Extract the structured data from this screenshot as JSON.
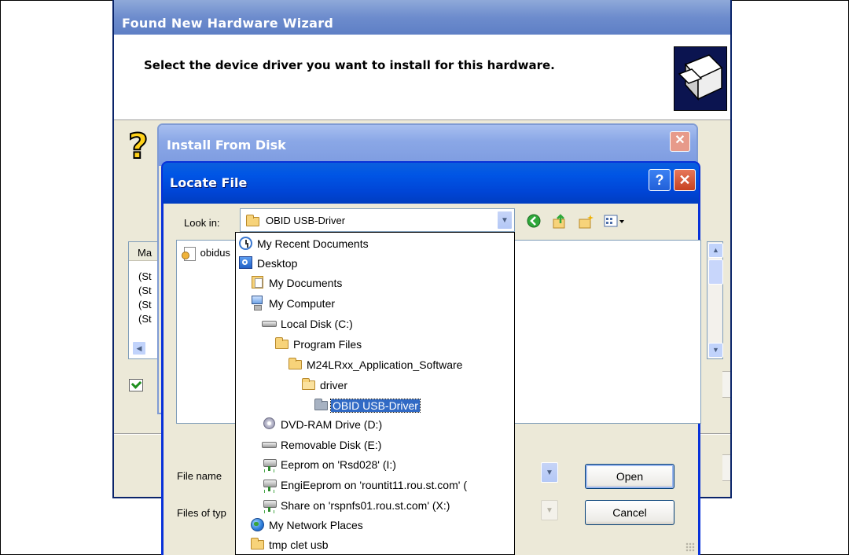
{
  "wizard": {
    "title": "Found New Hardware Wizard",
    "heading": "Select the device driver you want to install for this hardware."
  },
  "install_from_disk": {
    "title": "Install From Disk",
    "close_glyph": "✕"
  },
  "background_list": {
    "header": "Ma",
    "rows": [
      "(St",
      "(St",
      "(St",
      "(St"
    ]
  },
  "locate_file": {
    "title": "Locate File",
    "help_glyph": "?",
    "close_glyph": "✕",
    "look_in_label": "Look in:",
    "look_in_value": "OBID USB-Driver",
    "file_item": "obidus",
    "file_name_label": "File name",
    "files_of_type_label": "Files of typ",
    "open_button": "Open",
    "cancel_button": "Cancel"
  },
  "dropdown": {
    "items": [
      {
        "label": "My Recent Documents",
        "icon": "recent-documents-icon",
        "indent": 0
      },
      {
        "label": "Desktop",
        "icon": "desktop-icon",
        "indent": 0
      },
      {
        "label": "My Documents",
        "icon": "my-documents-icon",
        "indent": 1
      },
      {
        "label": "My Computer",
        "icon": "my-computer-icon",
        "indent": 1
      },
      {
        "label": "Local Disk (C:)",
        "icon": "hard-drive-icon",
        "indent": 2
      },
      {
        "label": "Program Files",
        "icon": "folder-icon",
        "indent": 3
      },
      {
        "label": "M24LRxx_Application_Software",
        "icon": "folder-icon",
        "indent": 4
      },
      {
        "label": "driver",
        "icon": "folder-icon",
        "indent": 5
      },
      {
        "label": "OBID USB-Driver",
        "icon": "folder-open-icon",
        "indent": 6,
        "selected": true
      },
      {
        "label": "DVD-RAM Drive (D:)",
        "icon": "dvd-drive-icon",
        "indent": 2
      },
      {
        "label": "Removable Disk (E:)",
        "icon": "removable-disk-icon",
        "indent": 2
      },
      {
        "label": "Eeprom on 'Rsd028' (I:)",
        "icon": "network-drive-icon",
        "indent": 2
      },
      {
        "label": "EngiEeprom on 'rountit11.rou.st.com' (",
        "icon": "network-drive-icon",
        "indent": 2
      },
      {
        "label": "Share on 'rspnfs01.rou.st.com' (X:)",
        "icon": "network-drive-icon",
        "indent": 2
      },
      {
        "label": "My Network Places",
        "icon": "network-places-icon",
        "indent": 1
      },
      {
        "label": "tmp clet usb",
        "icon": "folder-icon",
        "indent": 1
      }
    ]
  },
  "colors": {
    "xp_blue_title": "#0055e5",
    "selection": "#316ac5",
    "dialog_face": "#ece9d8"
  }
}
